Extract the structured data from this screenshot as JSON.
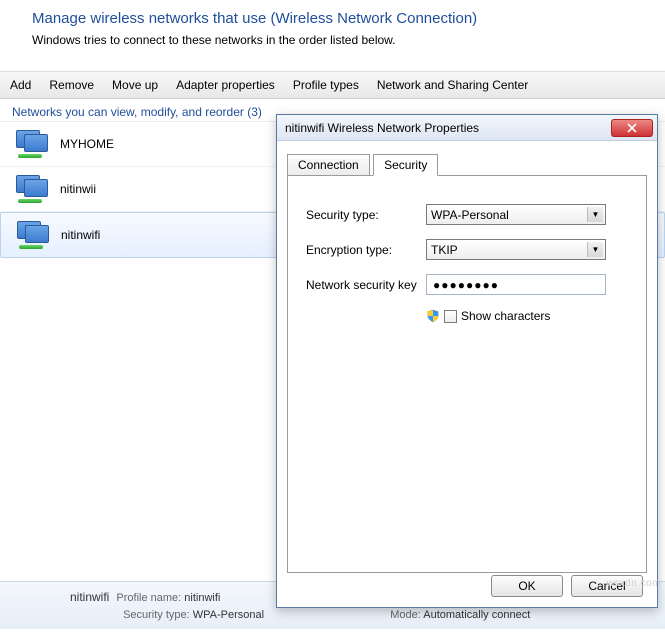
{
  "header": {
    "title": "Manage wireless networks that use (Wireless Network Connection)",
    "subtitle": "Windows tries to connect to these networks in the order listed below."
  },
  "toolbar": {
    "add": "Add",
    "remove": "Remove",
    "moveup": "Move up",
    "adapter": "Adapter properties",
    "profiles": "Profile types",
    "nsc": "Network and Sharing Center"
  },
  "list": {
    "caption": "Networks you can view, modify, and reorder (3)",
    "items": [
      {
        "name": "MYHOME"
      },
      {
        "name": "nitinwii"
      },
      {
        "name": "nitinwifi"
      }
    ],
    "selected_index": 2
  },
  "details": {
    "name": "nitinwifi",
    "profile_label": "Profile name:",
    "profile_value": "nitinwifi",
    "sectype_label": "Security type:",
    "sectype_value": "WPA-Personal",
    "mode_label": "Mode:",
    "mode_value": "Automatically connect"
  },
  "dialog": {
    "title": "nitinwifi Wireless Network Properties",
    "tabs": {
      "connection": "Connection",
      "security": "Security"
    },
    "security": {
      "sectype_label": "Security type:",
      "sectype_value": "WPA-Personal",
      "enctype_label": "Encryption type:",
      "enctype_value": "TKIP",
      "key_label": "Network security key",
      "key_value": "●●●●●●●●",
      "showchars_label": "Show characters"
    },
    "buttons": {
      "ok": "OK",
      "cancel": "Cancel"
    }
  },
  "watermark": "wsxdn.com"
}
